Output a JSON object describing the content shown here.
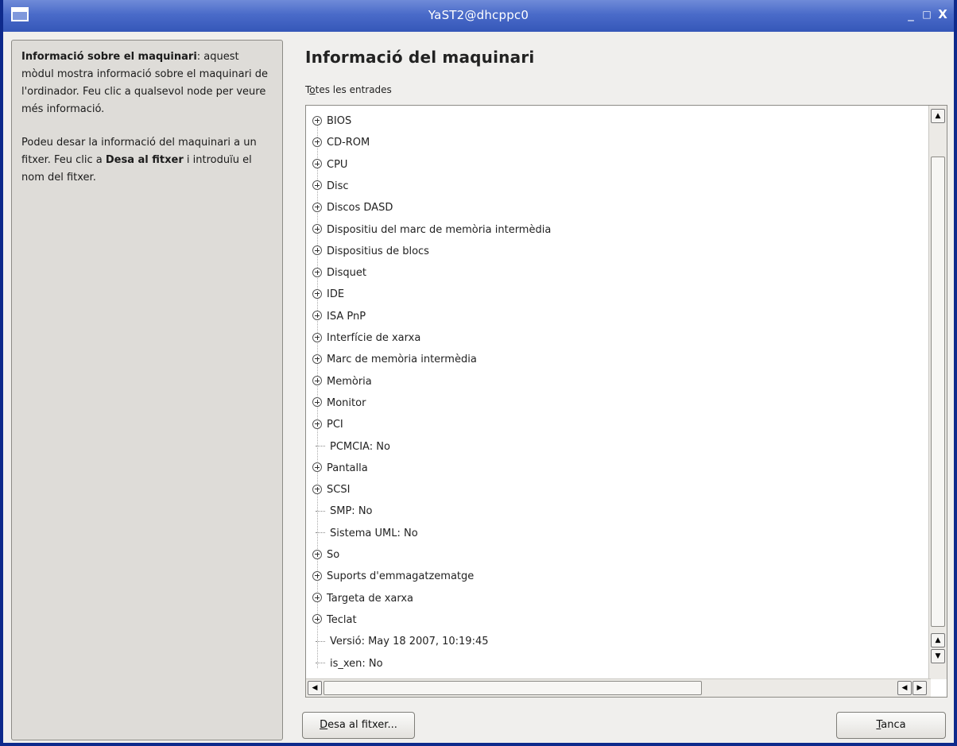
{
  "window": {
    "title": "YaST2@dhcppc0",
    "controls": {
      "minimize": "_",
      "maximize": "□",
      "close": "X"
    }
  },
  "help": {
    "p1_bold": "Informació sobre el maquinari",
    "p1_rest": ": aquest mòdul mostra informació sobre el maquinari de l'ordinador. Feu clic a qualsevol node per veure més informació.",
    "p2_start": "Podeu desar la informació del maquinari a un fitxer. Feu clic a ",
    "p2_bold": "Desa al fitxer",
    "p2_end": " i introduïu el nom del fitxer."
  },
  "main": {
    "title": "Informació del maquinari",
    "tree_label_pre": "T",
    "tree_label_mnemonic": "o",
    "tree_label_post": "tes les entrades"
  },
  "tree": {
    "items": [
      {
        "label": "BIOS",
        "expandable": true
      },
      {
        "label": "CD-ROM",
        "expandable": true
      },
      {
        "label": "CPU",
        "expandable": true
      },
      {
        "label": "Disc",
        "expandable": true
      },
      {
        "label": "Discos DASD",
        "expandable": true
      },
      {
        "label": "Dispositiu del marc de memòria intermèdia",
        "expandable": true
      },
      {
        "label": "Dispositius de blocs",
        "expandable": true
      },
      {
        "label": "Disquet",
        "expandable": true
      },
      {
        "label": "IDE",
        "expandable": true
      },
      {
        "label": "ISA PnP",
        "expandable": true
      },
      {
        "label": "Interfície de xarxa",
        "expandable": true
      },
      {
        "label": "Marc de memòria intermèdia",
        "expandable": true
      },
      {
        "label": "Memòria",
        "expandable": true
      },
      {
        "label": "Monitor",
        "expandable": true
      },
      {
        "label": "PCI",
        "expandable": true
      },
      {
        "label": "PCMCIA: No",
        "expandable": false
      },
      {
        "label": "Pantalla",
        "expandable": true
      },
      {
        "label": "SCSI",
        "expandable": true
      },
      {
        "label": "SMP: No",
        "expandable": false
      },
      {
        "label": "Sistema UML: No",
        "expandable": false
      },
      {
        "label": "So",
        "expandable": true
      },
      {
        "label": "Suports d'emmagatzematge",
        "expandable": true
      },
      {
        "label": "Targeta de xarxa",
        "expandable": true
      },
      {
        "label": "Teclat",
        "expandable": true
      },
      {
        "label": "Versió: May 18 2007, 10:19:45",
        "expandable": false
      },
      {
        "label": "is_xen: No",
        "expandable": false
      }
    ]
  },
  "buttons": {
    "save_mnemonic": "D",
    "save_rest": "esa al fitxer...",
    "close_mnemonic": "T",
    "close_rest": "anca"
  },
  "icons": {
    "up": "▲",
    "down": "▼",
    "left": "◀",
    "right": "▶"
  }
}
